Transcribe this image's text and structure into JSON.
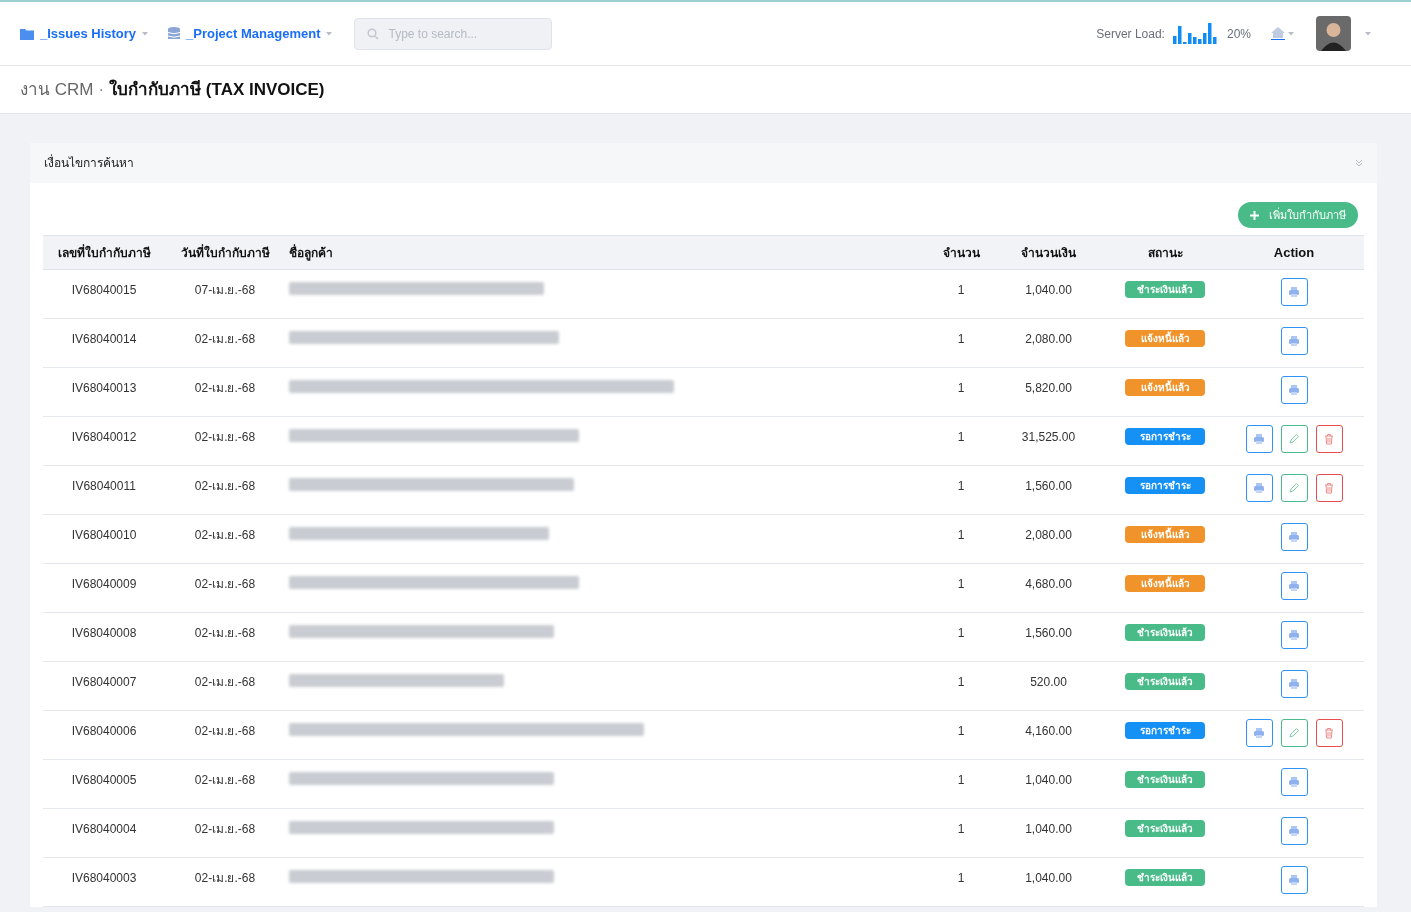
{
  "nav": {
    "menus": [
      {
        "label": "_Issues History"
      },
      {
        "label": "_Project Management"
      }
    ],
    "search": {
      "placeholder": "Type to search..."
    },
    "server_load": {
      "label": "Server Load:",
      "reading": "20%"
    }
  },
  "breadcrumb": {
    "parent": "งาน CRM",
    "separator": "·",
    "current": "ใบกำกับภาษี (TAX INVOICE)"
  },
  "filter_panel": {
    "title": "เงื่อนไขการค้นหา",
    "expanded": false
  },
  "add_button": "เพิ่มใบกำกับภาษี",
  "table": {
    "columns": [
      "เลขที่ใบกำกับภาษี",
      "วันที่ใบกำกับภาษี",
      "ชื่อลูกค้า",
      "จำนวน",
      "จำนวนเงิน",
      "สถานะ",
      "Action"
    ],
    "rows": [
      {
        "number": "IV68040015",
        "date": "07-เม.ย.-68",
        "qty": "1",
        "amount": "1,040.00",
        "status": "ชำระเงินแล้ว",
        "kind": "paid"
      },
      {
        "number": "IV68040014",
        "date": "02-เม.ย.-68",
        "qty": "1",
        "amount": "2,080.00",
        "status": "แจ้งหนี้แล้ว",
        "kind": "billed"
      },
      {
        "number": "IV68040013",
        "date": "02-เม.ย.-68",
        "qty": "1",
        "amount": "5,820.00",
        "status": "แจ้งหนี้แล้ว",
        "kind": "billed"
      },
      {
        "number": "IV68040012",
        "date": "02-เม.ย.-68",
        "qty": "1",
        "amount": "31,525.00",
        "status": "รอการชำระ",
        "kind": "pending"
      },
      {
        "number": "IV68040011",
        "date": "02-เม.ย.-68",
        "qty": "1",
        "amount": "1,560.00",
        "status": "รอการชำระ",
        "kind": "pending"
      },
      {
        "number": "IV68040010",
        "date": "02-เม.ย.-68",
        "qty": "1",
        "amount": "2,080.00",
        "status": "แจ้งหนี้แล้ว",
        "kind": "billed"
      },
      {
        "number": "IV68040009",
        "date": "02-เม.ย.-68",
        "qty": "1",
        "amount": "4,680.00",
        "status": "แจ้งหนี้แล้ว",
        "kind": "billed"
      },
      {
        "number": "IV68040008",
        "date": "02-เม.ย.-68",
        "qty": "1",
        "amount": "1,560.00",
        "status": "ชำระเงินแล้ว",
        "kind": "paid"
      },
      {
        "number": "IV68040007",
        "date": "02-เม.ย.-68",
        "qty": "1",
        "amount": "520.00",
        "status": "ชำระเงินแล้ว",
        "kind": "paid"
      },
      {
        "number": "IV68040006",
        "date": "02-เม.ย.-68",
        "qty": "1",
        "amount": "4,160.00",
        "status": "รอการชำระ",
        "kind": "pending"
      },
      {
        "number": "IV68040005",
        "date": "02-เม.ย.-68",
        "qty": "1",
        "amount": "1,040.00",
        "status": "ชำระเงินแล้ว",
        "kind": "paid"
      },
      {
        "number": "IV68040004",
        "date": "02-เม.ย.-68",
        "qty": "1",
        "amount": "1,040.00",
        "status": "ชำระเงินแล้ว",
        "kind": "paid"
      },
      {
        "number": "IV68040003",
        "date": "02-เม.ย.-68",
        "qty": "1",
        "amount": "1,040.00",
        "status": "ชำระเงินแล้ว",
        "kind": "paid"
      }
    ]
  }
}
